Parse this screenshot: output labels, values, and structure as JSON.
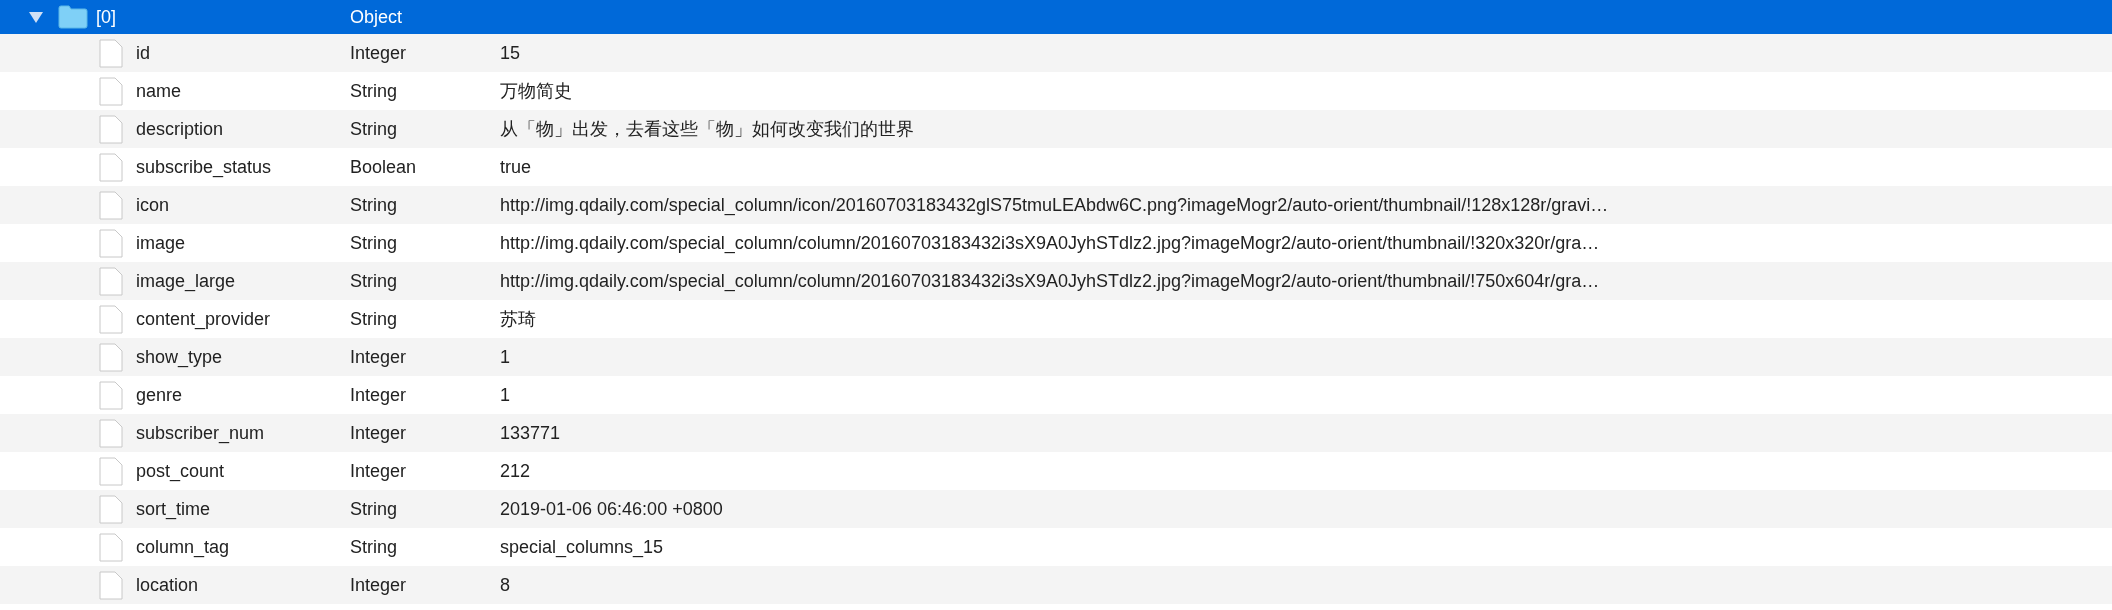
{
  "root": {
    "kind": "folder",
    "label": "[0]",
    "type": "Object",
    "expanded": true,
    "selected": true,
    "children": [
      {
        "kind": "file",
        "label": "id",
        "type": "Integer",
        "value": "15"
      },
      {
        "kind": "file",
        "label": "name",
        "type": "String",
        "value": "万物简史"
      },
      {
        "kind": "file",
        "label": "description",
        "type": "String",
        "value": "从「物」出发，去看这些「物」如何改变我们的世界"
      },
      {
        "kind": "file",
        "label": "subscribe_status",
        "type": "Boolean",
        "value": "true"
      },
      {
        "kind": "file",
        "label": "icon",
        "type": "String",
        "value": "http://img.qdaily.com/special_column/icon/20160703183432glS75tmuLEAbdw6C.png?imageMogr2/auto-orient/thumbnail/!128x128r/gravi…"
      },
      {
        "kind": "file",
        "label": "image",
        "type": "String",
        "value": "http://img.qdaily.com/special_column/column/20160703183432i3sX9A0JyhSTdlz2.jpg?imageMogr2/auto-orient/thumbnail/!320x320r/gra…"
      },
      {
        "kind": "file",
        "label": "image_large",
        "type": "String",
        "value": "http://img.qdaily.com/special_column/column/20160703183432i3sX9A0JyhSTdlz2.jpg?imageMogr2/auto-orient/thumbnail/!750x604r/gra…"
      },
      {
        "kind": "file",
        "label": "content_provider",
        "type": "String",
        "value": "苏琦"
      },
      {
        "kind": "file",
        "label": "show_type",
        "type": "Integer",
        "value": "1"
      },
      {
        "kind": "file",
        "label": "genre",
        "type": "Integer",
        "value": "1"
      },
      {
        "kind": "file",
        "label": "subscriber_num",
        "type": "Integer",
        "value": "133771"
      },
      {
        "kind": "file",
        "label": "post_count",
        "type": "Integer",
        "value": "212"
      },
      {
        "kind": "file",
        "label": "sort_time",
        "type": "String",
        "value": "2019-01-06 06:46:00 +0800"
      },
      {
        "kind": "file",
        "label": "column_tag",
        "type": "String",
        "value": "special_columns_15"
      },
      {
        "kind": "file",
        "label": "location",
        "type": "Integer",
        "value": "8"
      }
    ]
  }
}
